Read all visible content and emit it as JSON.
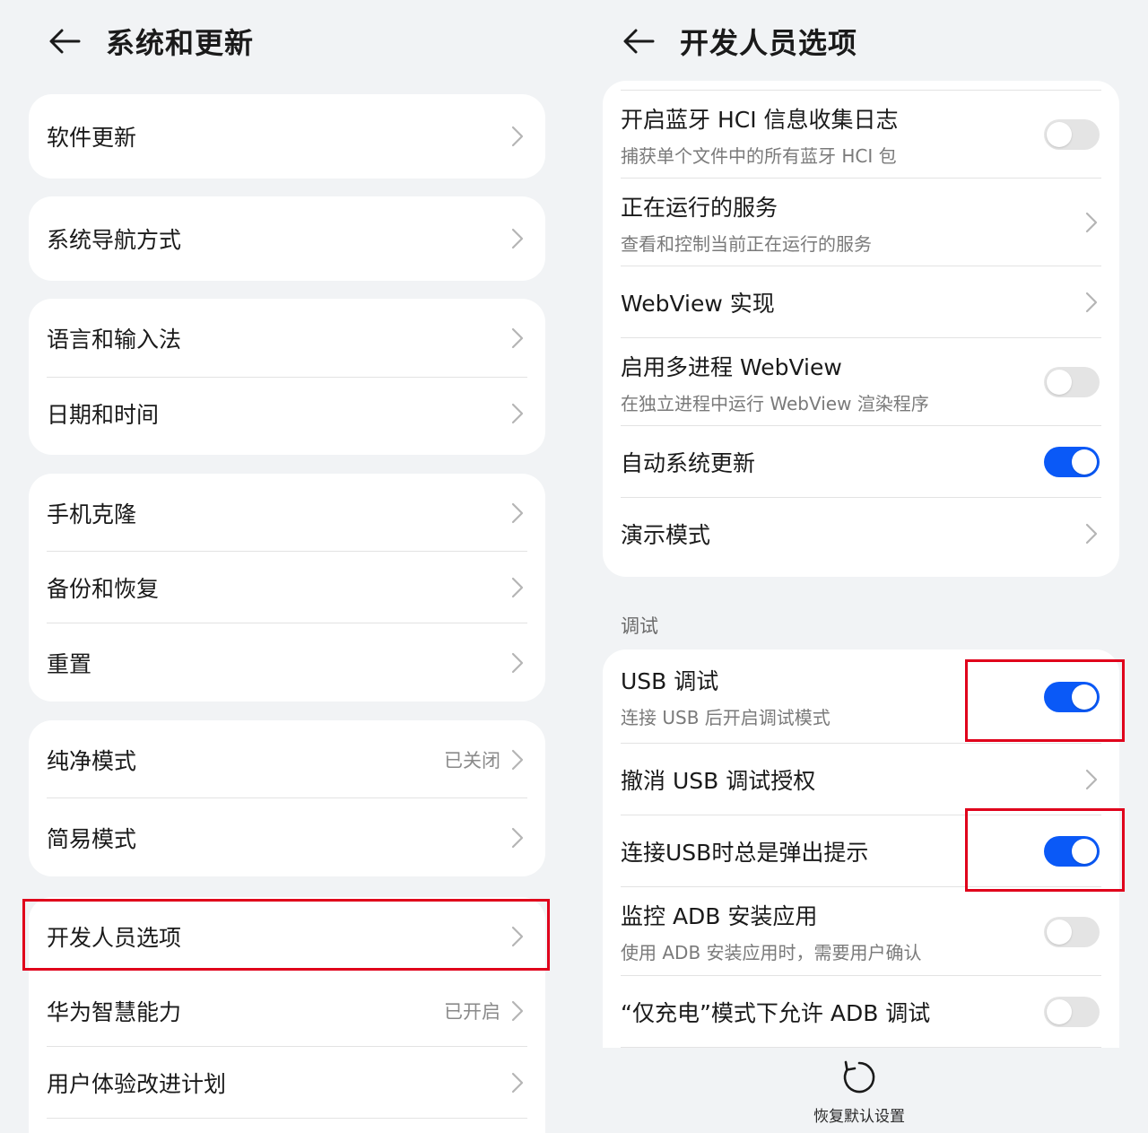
{
  "left": {
    "title": "系统和更新",
    "items": {
      "software_update": "软件更新",
      "navigation": "系统导航方式",
      "language": "语言和输入法",
      "datetime": "日期和时间",
      "phone_clone": "手机克隆",
      "backup": "备份和恢复",
      "reset": "重置",
      "pure_mode": "纯净模式",
      "pure_mode_value": "已关闭",
      "simple_mode": "简易模式",
      "developer_options": "开发人员选项",
      "huawei_ability": "华为智慧能力",
      "huawei_ability_value": "已开启",
      "ux_plan": "用户体验改进计划"
    }
  },
  "right": {
    "title": "开发人员选项",
    "items": {
      "bt_hci_title": "开启蓝牙 HCI 信息收集日志",
      "bt_hci_sub": "捕获单个文件中的所有蓝牙 HCI 包",
      "running_services_title": "正在运行的服务",
      "running_services_sub": "查看和控制当前正在运行的服务",
      "webview_impl": "WebView 实现",
      "multiprocess_title": "启用多进程 WebView",
      "multiprocess_sub": "在独立进程中运行 WebView 渲染程序",
      "auto_update": "自动系统更新",
      "demo_mode": "演示模式",
      "section_debug": "调试",
      "usb_debug_title": "USB 调试",
      "usb_debug_sub": "连接 USB 后开启调试模式",
      "revoke_usb": "撤消 USB 调试授权",
      "usb_prompt": "连接USB时总是弹出提示",
      "adb_monitor_title": "监控 ADB 安装应用",
      "adb_monitor_sub": "使用 ADB 安装应用时，需要用户确认",
      "charge_only_adb": "“仅充电”模式下允许 ADB 调试",
      "restore_defaults": "恢复默认设置"
    },
    "toggles": {
      "bt_hci": false,
      "multiprocess_webview": false,
      "auto_update": true,
      "usb_debug": true,
      "usb_prompt": true,
      "adb_monitor": false,
      "charge_only_adb": false
    }
  },
  "colors": {
    "accent": "#0a59f7",
    "highlight": "#e0001b",
    "background": "#f1f3f5"
  }
}
